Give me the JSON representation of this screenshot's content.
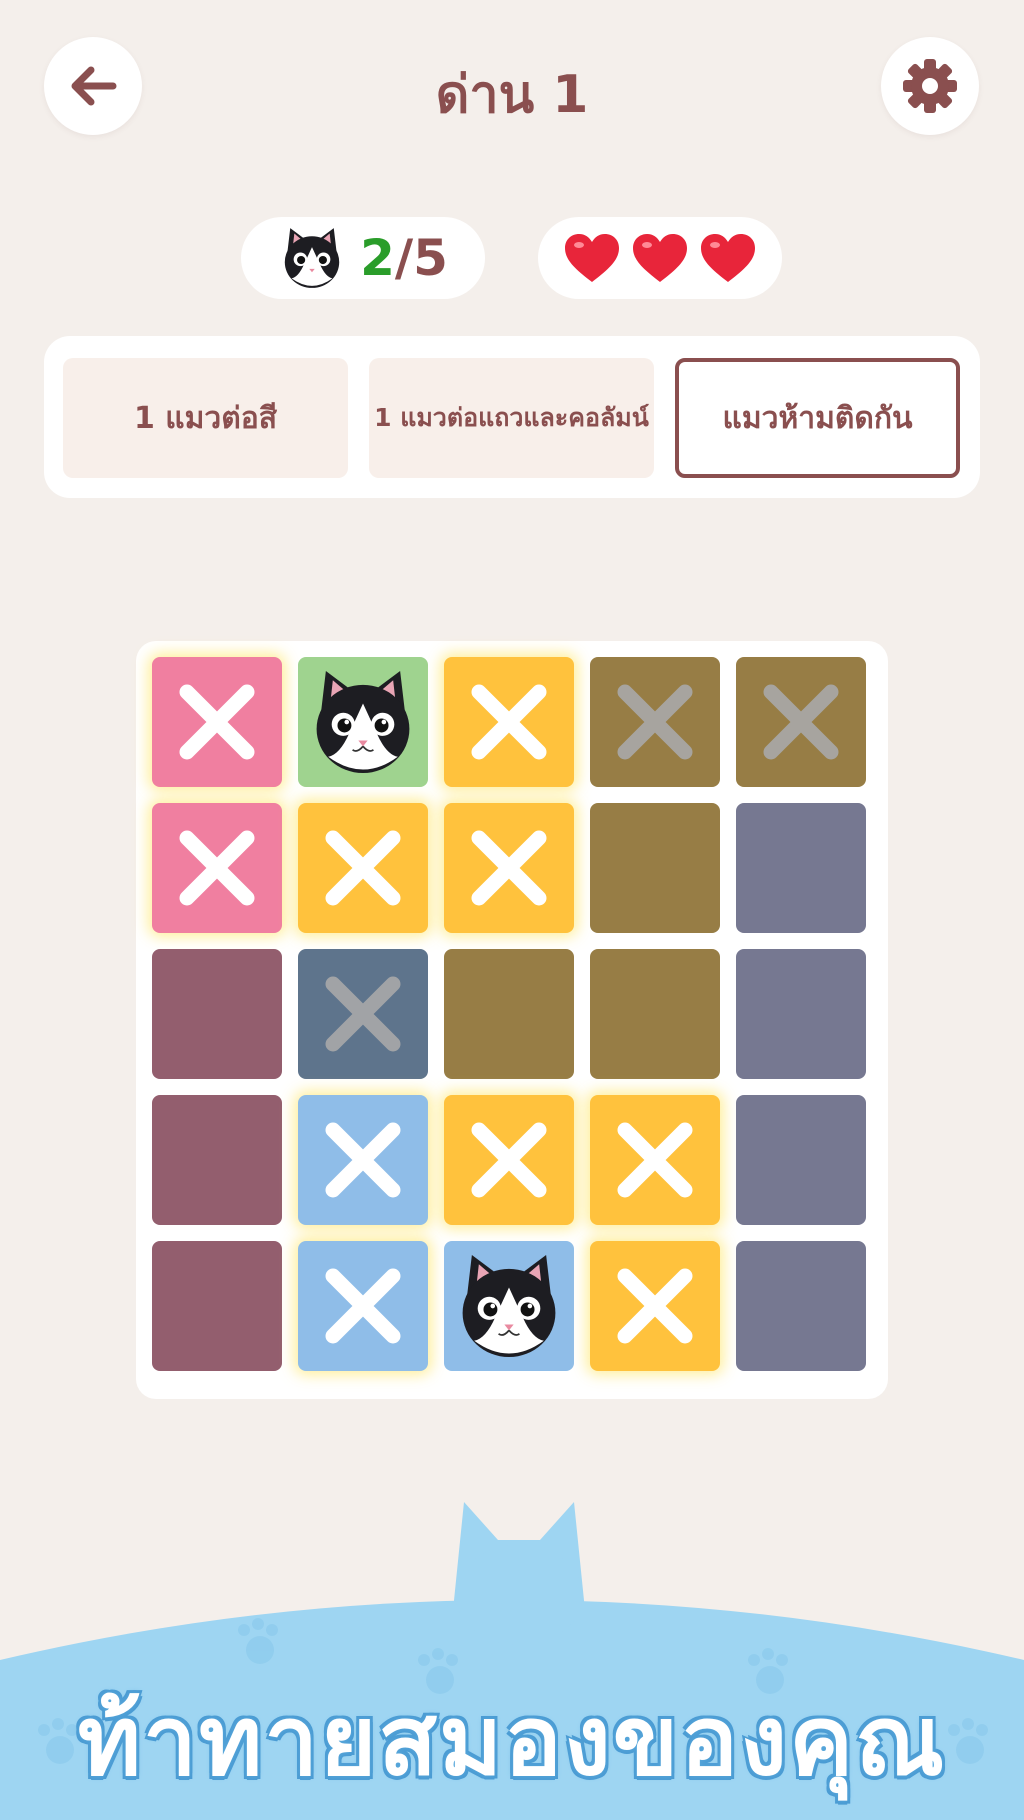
{
  "header": {
    "title": "ด่าน 1",
    "back_icon": "arrow-left-icon",
    "settings_icon": "gear-icon"
  },
  "stats": {
    "cats_found": "2",
    "cats_sep": "/",
    "cats_total": "5",
    "lives": 3,
    "cat_icon": "cat-face-icon",
    "life_icon": "heart-icon"
  },
  "rules": [
    {
      "label": "1 แมวต่อสี",
      "active": false
    },
    {
      "label": "1 แมวต่อแถวและคอลัมน์",
      "active": false
    },
    {
      "label": "แมวห้ามติดกัน",
      "active": true
    }
  ],
  "colors": {
    "pink": "#f07fa0",
    "green": "#9fd38f",
    "yellow": "#ffc23d",
    "olive": "#977d45",
    "slate": "#767891",
    "plum": "#935e6e",
    "steel": "#5e748c",
    "blue": "#8fbde8",
    "accent": "#8a4f4f",
    "found_green": "#2a9d2a",
    "sky": "#9ed5f2"
  },
  "board": {
    "rows": 5,
    "cols": 5,
    "cells": [
      [
        {
          "color": "pink",
          "mark": "x",
          "glow": true
        },
        {
          "color": "green",
          "mark": "cat",
          "glow": false
        },
        {
          "color": "yellow",
          "mark": "x",
          "glow": true
        },
        {
          "color": "olive",
          "mark": "x-faded",
          "glow": false
        },
        {
          "color": "olive",
          "mark": "x-faded",
          "glow": false
        }
      ],
      [
        {
          "color": "pink",
          "mark": "x",
          "glow": true
        },
        {
          "color": "yellow",
          "mark": "x",
          "glow": true
        },
        {
          "color": "yellow",
          "mark": "x",
          "glow": true
        },
        {
          "color": "olive",
          "mark": "",
          "glow": false
        },
        {
          "color": "slate",
          "mark": "",
          "glow": false
        }
      ],
      [
        {
          "color": "plum",
          "mark": "",
          "glow": false
        },
        {
          "color": "steel",
          "mark": "x-faded",
          "glow": false
        },
        {
          "color": "olive",
          "mark": "",
          "glow": false
        },
        {
          "color": "olive",
          "mark": "",
          "glow": false
        },
        {
          "color": "slate",
          "mark": "",
          "glow": false
        }
      ],
      [
        {
          "color": "plum",
          "mark": "",
          "glow": false
        },
        {
          "color": "blue",
          "mark": "x",
          "glow": true
        },
        {
          "color": "yellow",
          "mark": "x",
          "glow": true
        },
        {
          "color": "yellow",
          "mark": "x",
          "glow": true
        },
        {
          "color": "slate",
          "mark": "",
          "glow": false
        }
      ],
      [
        {
          "color": "plum",
          "mark": "",
          "glow": false
        },
        {
          "color": "blue",
          "mark": "x",
          "glow": true
        },
        {
          "color": "blue",
          "mark": "cat",
          "glow": false
        },
        {
          "color": "yellow",
          "mark": "x",
          "glow": true
        },
        {
          "color": "slate",
          "mark": "",
          "glow": false
        }
      ]
    ]
  },
  "footer": {
    "slogan": "ท้าทายสมองของคุณ",
    "decor_icon": "cat-silhouette-icon"
  }
}
